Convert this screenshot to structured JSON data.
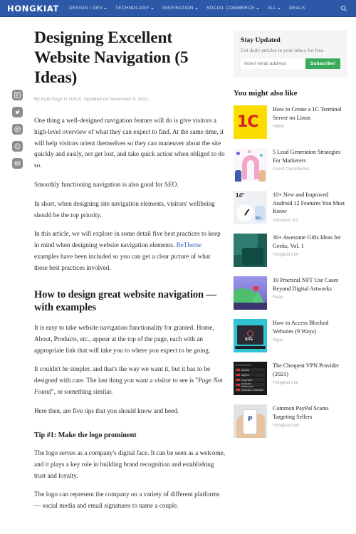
{
  "nav": {
    "logo": "HONGKIAT",
    "items": [
      {
        "label": "DESIGN / DEV",
        "caret": true
      },
      {
        "label": "TECHNOLOGY",
        "caret": true
      },
      {
        "label": "INSPIRATION",
        "caret": true
      },
      {
        "label": "SOCIAL COMMERCE",
        "caret": true
      },
      {
        "label": "ALL",
        "caret": true
      },
      {
        "label": "DEALS",
        "caret": false
      }
    ],
    "search_icon": "search-icon",
    "bg_color": "#2d58a7"
  },
  "share": {
    "items": [
      {
        "name": "facebook-share-icon",
        "label": "Facebook"
      },
      {
        "name": "twitter-share-icon",
        "label": "Twitter"
      },
      {
        "name": "pinterest-share-icon",
        "label": "Pinterest"
      },
      {
        "name": "whatsapp-share-icon",
        "label": "WhatsApp"
      },
      {
        "name": "email-share-icon",
        "label": "Email"
      }
    ]
  },
  "article": {
    "title": "Designing Excellent Website Navigation (5 Ideas)",
    "byline": "By Kate Dagli in UI/UX. Updated on November 9, 2021.",
    "p1": "One thing a well-designed navigation feature will do is give visitors a high-level overview of what they can expect to find. At the same time, it will help visitors orient themselves so they can maneuver about the site quickly and easily, not get lost, and take quick action when obliged to do so.",
    "p2": "Smoothly functioning navigation is also good for SEO.",
    "p3": "In short, when designing site navigation elements, visitors' wellbeing should be the top priority.",
    "p4_before": "In this article, we will explore in some detail five best practices to keep in mind when designing website navigation elements. ",
    "p4_link": "BeTheme",
    "p4_after": " examples have been included so you can get a clear picture of what these best practices involved.",
    "h2": "How to design great website navigation — with examples",
    "p5": "It is easy to take website navigation functionality for granted. Home, About, Products, etc., appear at the top of the page, each with an appropriate link that will take you to where you expect to be going.",
    "p6_before": "It couldn't be simpler, and that's the way we want it, but it has to be designed with care. The last thing you want a visitor to see is \"",
    "p6_em": "Page Not Found",
    "p6_after": "\", or something similar.",
    "p7": "Here then, are five tips that you should know and heed.",
    "h3": "Tip #1: Make the logo prominent",
    "p8": "The logo serves as a company's digital face. It can be seen as a welcome, and it plays a key role in building brand recognition and establishing trust and loyalty.",
    "p9": "The logo can represent the company on a variety of different platforms — social media and email signatures to name a couple."
  },
  "sidebar": {
    "stay_updated": {
      "heading": "Stay Updated",
      "subtext": "Get daily articles in your inbox for free.",
      "email_placeholder": "Insert email address",
      "email_value": "",
      "button_label": "Subscribe!",
      "button_color": "#3aab5c"
    },
    "related_heading": "You might also like",
    "related": [
      {
        "title": "How to Create a 1C Terminal Server on Linux",
        "author": "Nikita",
        "thumb": "t1"
      },
      {
        "title": "5 Lead Generation Strategies For Marketers",
        "author": "Guest Contributors",
        "thumb": "t2"
      },
      {
        "title": "10+ New and Improved Android 12 Features You Must Know",
        "author": "Ashutosh KS",
        "thumb": "t3"
      },
      {
        "title": "30+ Awesome Gifts Ideas for Geeks, Vol. 1",
        "author": "Hongkiat Lim",
        "thumb": "t4"
      },
      {
        "title": "10 Practical NFT Use Cases Beyond Digital Artworks",
        "author": "Roan",
        "thumb": "t5"
      },
      {
        "title": "How to Access Blocked Websites (9 Ways)",
        "author": "Agus",
        "thumb": "t6"
      },
      {
        "title": "The Cheapest VPN Provider (2021)",
        "author": "Hongkiat Lim",
        "thumb": "t7"
      },
      {
        "title": "Common PayPal Scams Targeting Sellers",
        "author": "Hongkiat.com",
        "thumb": "t8"
      }
    ]
  }
}
